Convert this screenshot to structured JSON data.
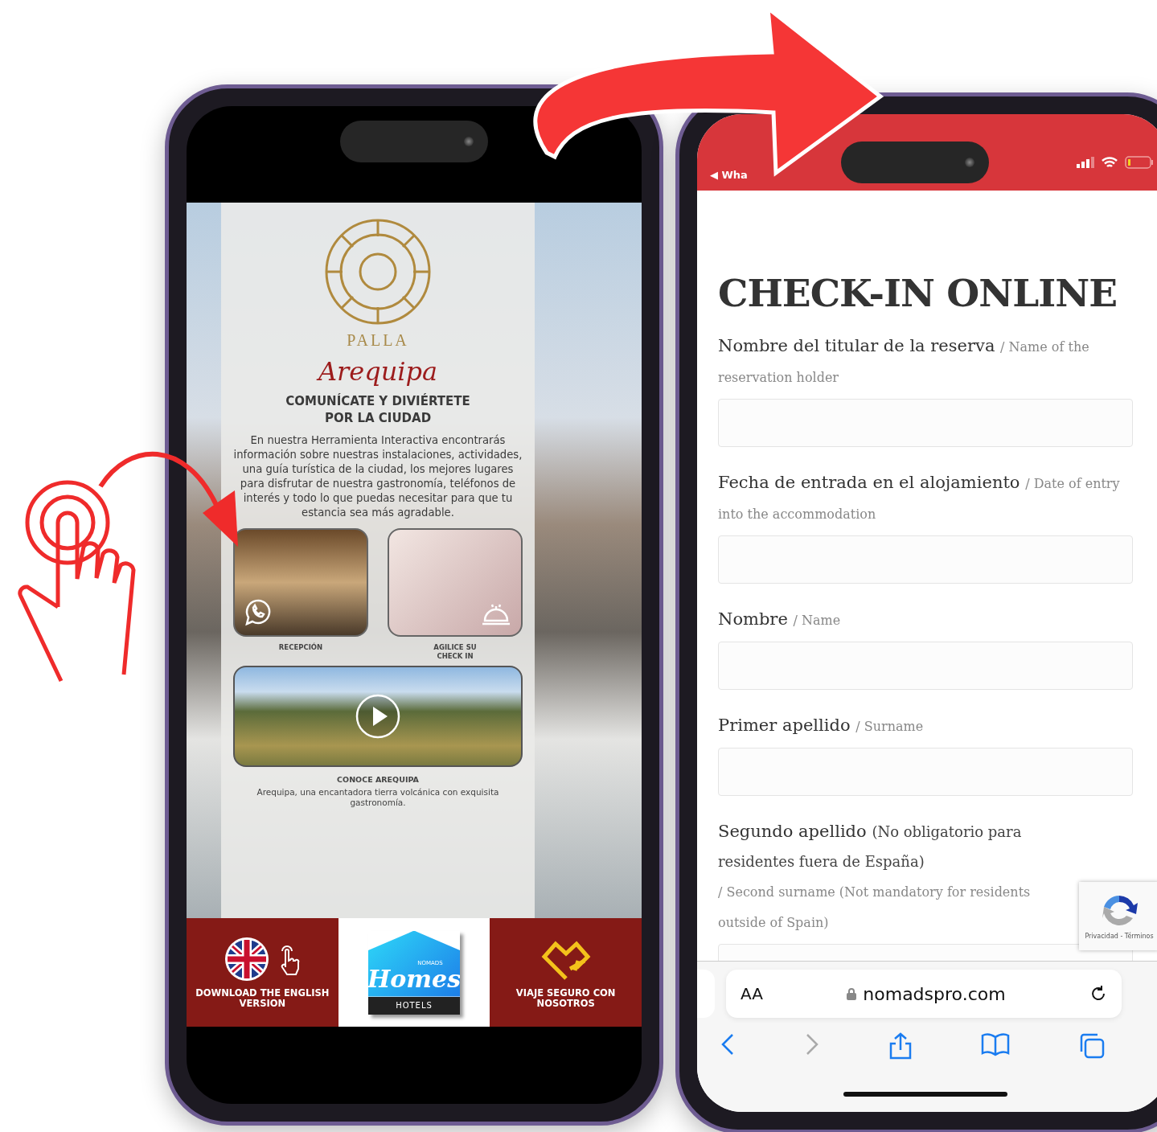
{
  "left_phone": {
    "brand": "PALLA",
    "city": "Arequipa",
    "headline": "COMUNÍCATE Y DIVIÉRTETE POR LA CIUDAD",
    "intro": "En nuestra Herramienta Interactiva encontrarás información sobre nuestras instalaciones, actividades, una guía turística de la ciudad, los mejores lugares para disfrutar de nuestra gastronomía, teléfonos de interés y todo lo que puedas necesitar para que tu estancia sea más agradable.",
    "cards": [
      {
        "kind": "reception",
        "label": "RECEPCIÓN"
      },
      {
        "kind": "checkin",
        "label": "AGILICE SU CHECK IN"
      }
    ],
    "video": {
      "title": "CONOCE AREQUIPA",
      "caption": "Arequipa, una encantadora tierra volcánica con exquisita gastronomía."
    },
    "bottom_bar": [
      {
        "kind": "flag",
        "label": "DOWNLOAD THE ENGLISH VERSION"
      },
      {
        "kind": "logo",
        "small": "NOMADS",
        "script": "Homes",
        "label": "HOTELS"
      },
      {
        "kind": "heart",
        "label": "VIAJE SEGURO CON NOSOTROS"
      }
    ]
  },
  "right_phone": {
    "back_link": "◀ Wha",
    "title": "CHECK-IN ONLINE",
    "fields": [
      {
        "label": "Nombre del titular de la reserva",
        "translation": "/ Name of the reservation holder"
      },
      {
        "label": "Fecha de entrada en el alojamiento",
        "translation": "/ Date of entry into the accommodation"
      },
      {
        "label": "Nombre",
        "translation": "/ Name"
      },
      {
        "label": "Primer apellido",
        "translation": "/ Surname"
      },
      {
        "label": "Segundo apellido",
        "note": "(No obligatorio para residentes fuera de España)",
        "translation": "/ Second surname (Not mandatory for residents outside of Spain)"
      }
    ],
    "recaptcha": "Privacidad - Términos",
    "address_bar": {
      "text_size": "AA",
      "url": "nomadspro.com"
    }
  }
}
